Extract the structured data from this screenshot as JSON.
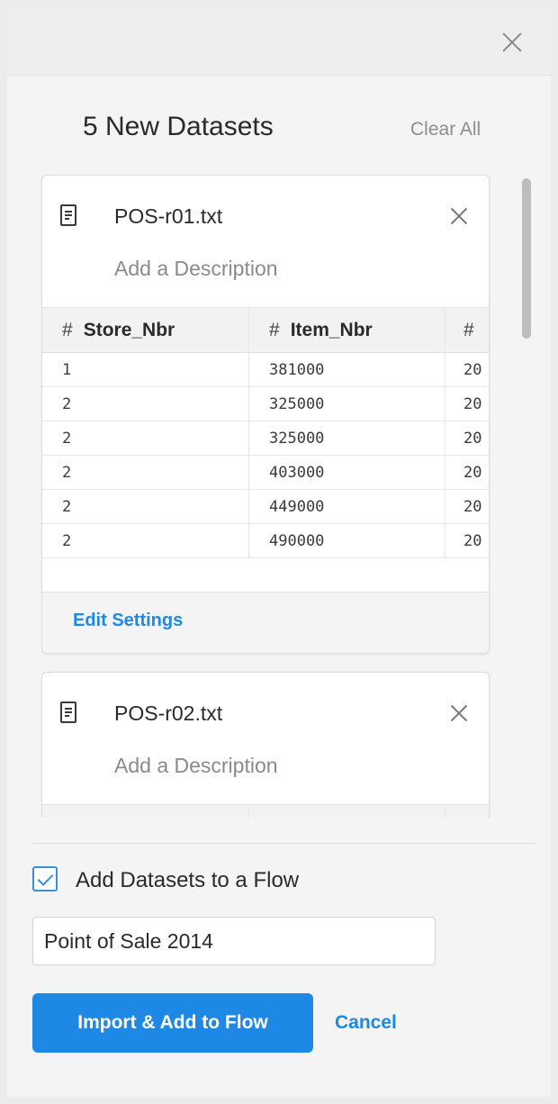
{
  "panel": {
    "title": "5 New Datasets",
    "clear_all": "Clear All"
  },
  "datasets": [
    {
      "file_name": "POS-r01.txt",
      "description_placeholder": "Add a Description",
      "columns": [
        {
          "type_icon": "#",
          "name": "Store_Nbr"
        },
        {
          "type_icon": "#",
          "name": "Item_Nbr"
        },
        {
          "type_icon": "#",
          "name": ""
        }
      ],
      "rows": [
        [
          "1",
          "381000",
          "20"
        ],
        [
          "2",
          "325000",
          "20"
        ],
        [
          "2",
          "325000",
          "20"
        ],
        [
          "2",
          "403000",
          "20"
        ],
        [
          "2",
          "449000",
          "20"
        ],
        [
          "2",
          "490000",
          "20"
        ]
      ],
      "edit_settings": "Edit Settings"
    },
    {
      "file_name": "POS-r02.txt",
      "description_placeholder": "Add a Description"
    }
  ],
  "flow": {
    "checkbox_checked": true,
    "checkbox_label": "Add Datasets to a Flow",
    "flow_name_value": "Point of Sale 2014"
  },
  "actions": {
    "primary": "Import & Add to Flow",
    "cancel": "Cancel"
  },
  "colors": {
    "accent": "#1e88e5",
    "panel_bg": "#f4f4f4"
  }
}
